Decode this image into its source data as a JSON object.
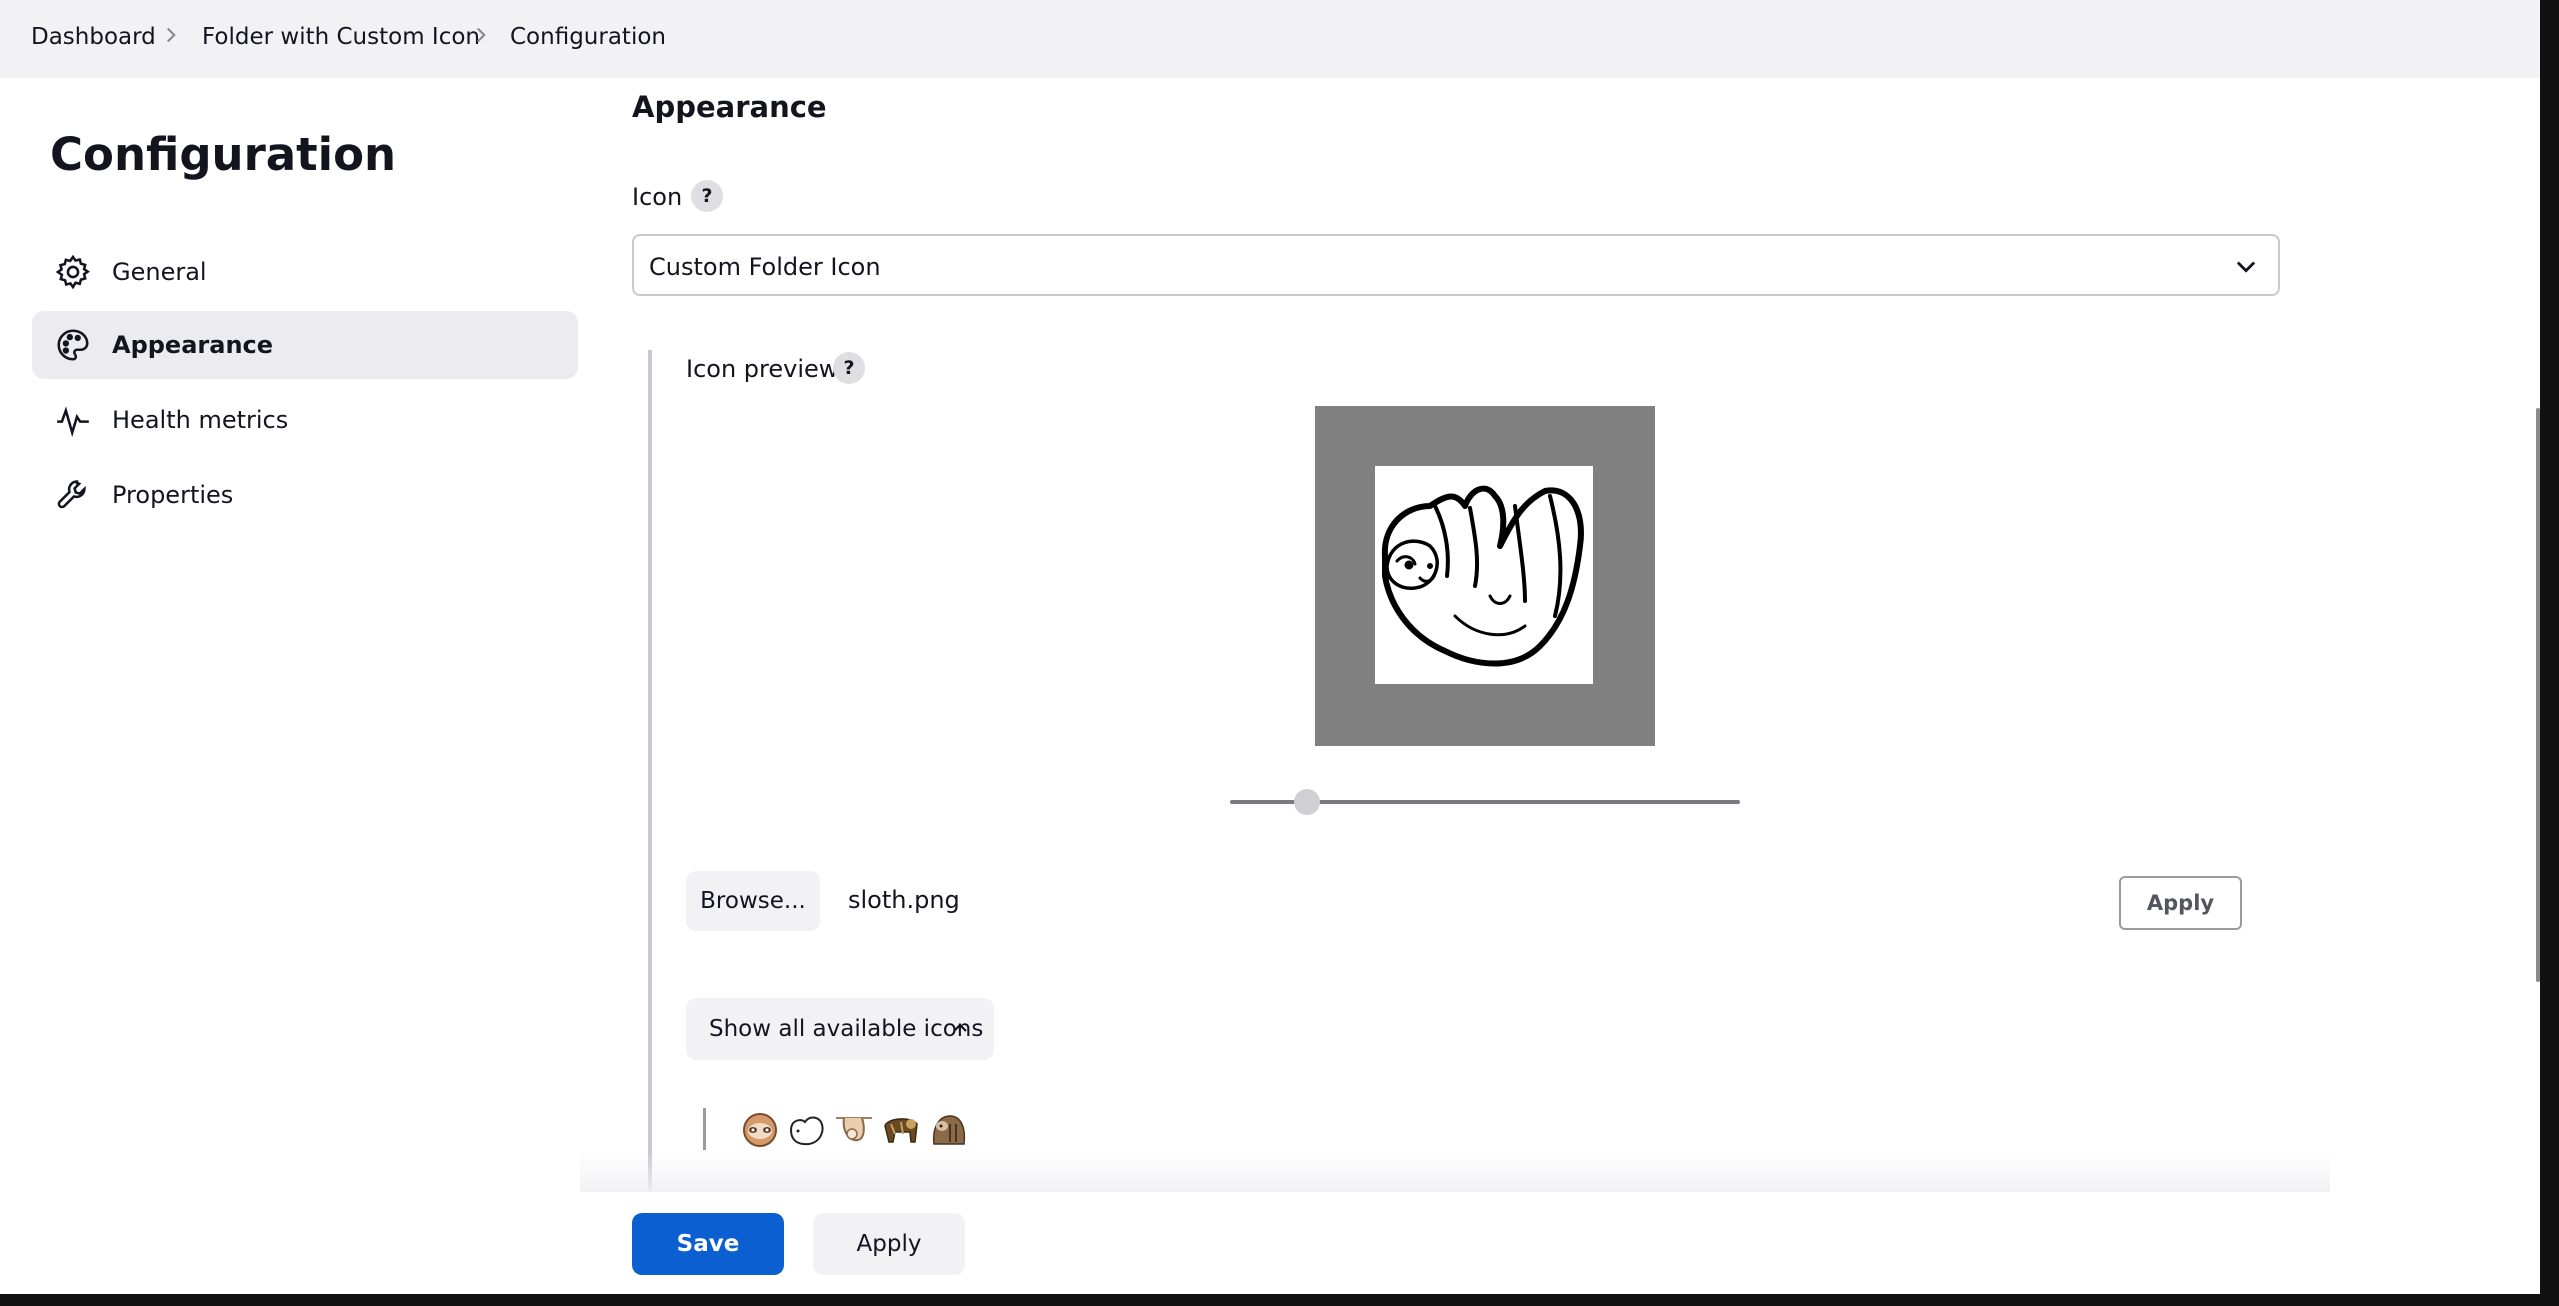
{
  "breadcrumb": {
    "items": [
      "Dashboard",
      "Folder with Custom Icon",
      "Configuration"
    ]
  },
  "sidebar": {
    "title": "Configuration",
    "items": [
      {
        "label": "General",
        "icon": "gear-icon"
      },
      {
        "label": "Appearance",
        "icon": "palette-icon",
        "active": true
      },
      {
        "label": "Health metrics",
        "icon": "pulse-icon"
      },
      {
        "label": "Properties",
        "icon": "wrench-icon"
      }
    ]
  },
  "main": {
    "section_title": "Appearance",
    "icon_label": "Icon",
    "help_glyph": "?",
    "icon_select_value": "Custom Folder Icon",
    "preview_label": "Icon preview",
    "preview_image": "sloth-image",
    "zoom_slider_fraction": 0.15,
    "browse_label": "Browse...",
    "file_name": "sloth.png",
    "upload_apply_label": "Apply",
    "show_icons_label": "Show all available icons",
    "available_icons": [
      "sloth-face-icon",
      "hanging-sloth-icon",
      "sloth-climbing-icon",
      "sloth-walking-icon",
      "sloth-sitting-icon"
    ]
  },
  "footer": {
    "save_label": "Save",
    "apply_label": "Apply"
  },
  "colors": {
    "primary": "#0b5fd0",
    "sidebar_active_bg": "#ececf0",
    "topbar_bg": "#f2f2f5",
    "preview_bg": "#808080"
  }
}
